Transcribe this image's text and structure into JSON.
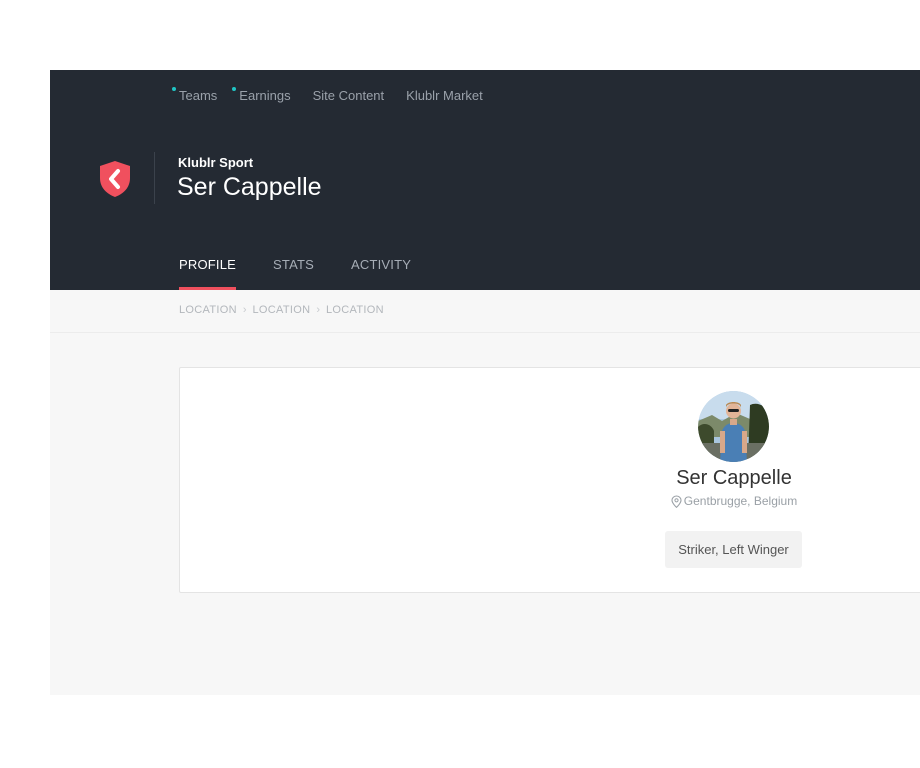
{
  "topnav": {
    "items": [
      {
        "label": "Teams",
        "has_dot": true
      },
      {
        "label": "Earnings",
        "has_dot": true
      },
      {
        "label": "Site Content",
        "has_dot": false
      },
      {
        "label": "Klublr Market",
        "has_dot": false
      }
    ]
  },
  "header": {
    "org_name": "Klublr Sport",
    "title": "Ser Cappelle",
    "logo_icon": "klublr-shield-icon"
  },
  "tabs": [
    {
      "label": "PROFILE",
      "active": true
    },
    {
      "label": "STATS",
      "active": false
    },
    {
      "label": "ACTIVITY",
      "active": false
    }
  ],
  "breadcrumb": [
    "LOCATION",
    "LOCATION",
    "LOCATION"
  ],
  "profile": {
    "name": "Ser Cappelle",
    "location": "Gentbrugge, Belgium",
    "location_icon": "map-pin-icon",
    "position": "Striker, Left Winger"
  },
  "colors": {
    "header_bg": "#242a33",
    "accent": "#f0505e",
    "notification_dot": "#20c4c4"
  }
}
